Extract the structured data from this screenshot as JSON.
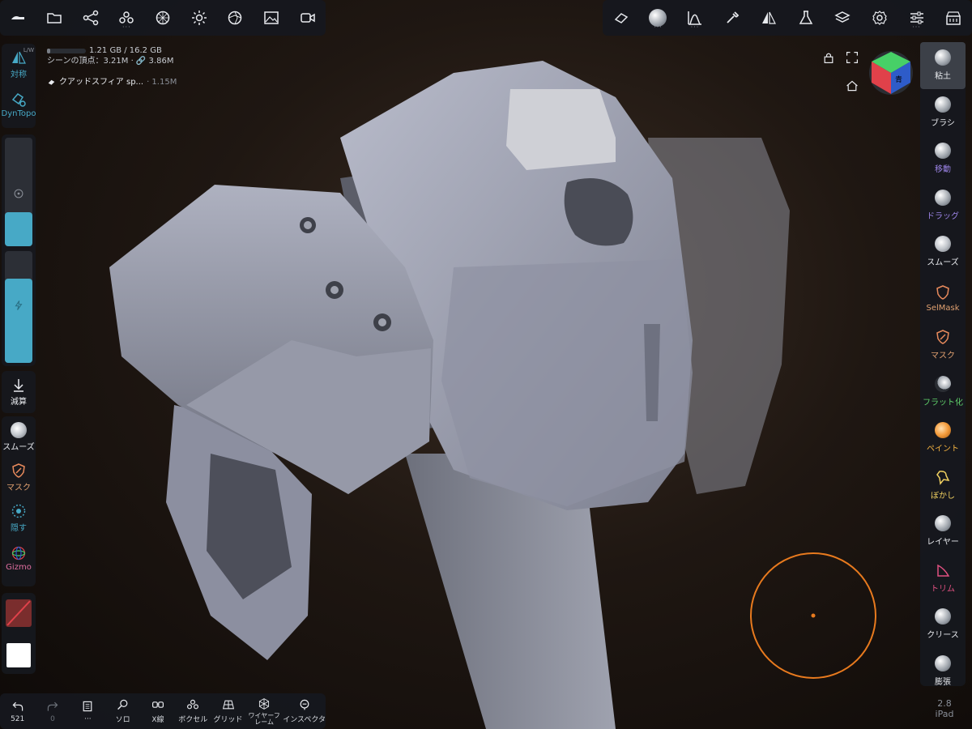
{
  "colors": {
    "accent": "#47a9c6",
    "brush_ring": "#e87a1e",
    "panel": "#16181e"
  },
  "info": {
    "memory": "1.21 GB / 16.2 GB",
    "memory_fraction": 0.075,
    "vertices": "シーンの頂点：3.21M · 🔗 3.86M",
    "object": "クアッドスフィア sp...",
    "object_verts": "· 1.15M"
  },
  "left": {
    "symmetry_badge": "L/W",
    "symmetry": "対称",
    "dyntopo": "DynTopo",
    "subtract": "減算",
    "smooth": "スムーズ",
    "mask": "マスク",
    "hide": "隠す",
    "gizmo": "Gizmo"
  },
  "right": {
    "tools": [
      "粘土",
      "ブラシ",
      "移動",
      "ドラッグ",
      "スムーズ",
      "SelMask",
      "マスク",
      "フラット化",
      "ペイント",
      "ぼかし",
      "レイヤー",
      "トリム",
      "クリース",
      "膨張"
    ]
  },
  "bottom": {
    "undo_count": "521",
    "redo_count": "0",
    "tools": [
      "ソロ",
      "X線",
      "ボクセル",
      "グリッド",
      "ワイヤーフレーム",
      "インスペクタ"
    ]
  },
  "version": {
    "number": "2.8",
    "device": "iPad"
  },
  "gizmo": {
    "top_face": "青"
  }
}
